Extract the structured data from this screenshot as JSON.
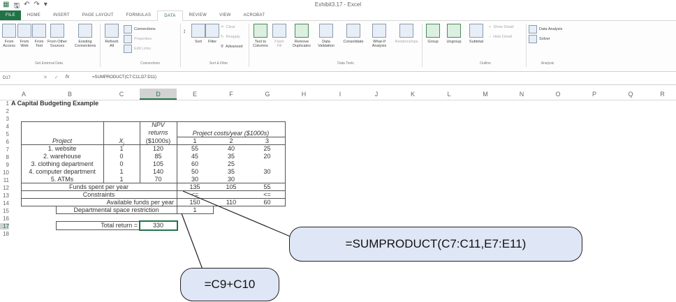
{
  "window": {
    "title": "Exhibit3.17 - Excel"
  },
  "tabs": [
    {
      "label": "FILE"
    },
    {
      "label": "HOME"
    },
    {
      "label": "INSERT"
    },
    {
      "label": "PAGE LAYOUT"
    },
    {
      "label": "FORMULAS"
    },
    {
      "label": "DATA"
    },
    {
      "label": "REVIEW"
    },
    {
      "label": "VIEW"
    },
    {
      "label": "ACROBAT"
    }
  ],
  "ribbon": {
    "from_access": "From Access",
    "from_web": "From Web",
    "from_text": "From Text",
    "from_other": "From Other Sources",
    "existing": "Existing Connections",
    "refresh": "Refresh All",
    "connections": "Connections",
    "properties": "Properties",
    "edit_links": "Edit Links",
    "sort": "Sort",
    "filter": "Filter",
    "clear": "Clear",
    "reapply": "Reapply",
    "advanced": "Advanced",
    "text_to_cols": "Text to Columns",
    "flash_fill": "Flash Fill",
    "remove_dup": "Remove Duplicates",
    "data_val": "Data Validation",
    "consolidate": "Consolidate",
    "whatif": "What-If Analysis",
    "relationships": "Relationships",
    "group": "Group",
    "ungroup": "Ungroup",
    "subtotal": "Subtotal",
    "show_detail": "Show Detail",
    "hide_detail": "Hide Detail",
    "data_analysis": "Data Analysis",
    "solver": "Solver",
    "groups": {
      "get_external": "Get External Data",
      "connections": "Connections",
      "sort_filter": "Sort & Filter",
      "data_tools": "Data Tools",
      "outline": "Outline",
      "analysis": "Analysis"
    }
  },
  "formula_bar": {
    "name_box": "D17",
    "formula": "=SUMPRODUCT(C7:C11,D7:D11)"
  },
  "columns": [
    "A",
    "B",
    "C",
    "D",
    "E",
    "F",
    "G",
    "H",
    "I",
    "J",
    "K",
    "L",
    "M",
    "N",
    "O",
    "P",
    "Q",
    "R"
  ],
  "rows": [
    "1",
    "2",
    "3",
    "4",
    "5",
    "6",
    "7",
    "8",
    "9",
    "10",
    "11",
    "12",
    "13",
    "14",
    "15",
    "16",
    "17",
    "18"
  ],
  "sheet": {
    "title": "A Capital Budgeting Example",
    "hdr_npv1": "NPV",
    "hdr_npv2": "returns",
    "hdr_costs": "Project costs/year ($1000s)",
    "hdr_project": "Project",
    "hdr_x": "X",
    "hdr_x_sub": "j",
    "hdr_units": "($1000s)",
    "hdr_y1": "1",
    "hdr_y2": "2",
    "hdr_y3": "3",
    "projects": [
      {
        "name": "1. website",
        "x": "1",
        "npv": "120",
        "c1": "55",
        "c2": "40",
        "c3": "25"
      },
      {
        "name": "2. warehouse",
        "x": "0",
        "npv": "85",
        "c1": "45",
        "c2": "35",
        "c3": "20"
      },
      {
        "name": "3. clothing department",
        "x": "0",
        "npv": "105",
        "c1": "60",
        "c2": "25",
        "c3": ""
      },
      {
        "name": "4. computer department",
        "x": "1",
        "npv": "140",
        "c1": "50",
        "c2": "35",
        "c3": "30"
      },
      {
        "name": "5. ATMs",
        "x": "1",
        "npv": "70",
        "c1": "30",
        "c2": "30",
        "c3": ""
      }
    ],
    "funds_spent_label": "Funds spent per year",
    "funds_spent": [
      "135",
      "105",
      "55"
    ],
    "constraints_label": "Constraints",
    "constraints": [
      "<=",
      "",
      "<="
    ],
    "available_label": "Available funds per year",
    "available": [
      "150",
      "110",
      "60"
    ],
    "space_label": "Departmental space restriction",
    "space_value": "1",
    "total_label": "Total return =",
    "total_value": "330"
  },
  "callouts": {
    "sumproduct": "=SUMPRODUCT(C7:C11,E7:E11)",
    "c9c10": "=C9+C10"
  }
}
